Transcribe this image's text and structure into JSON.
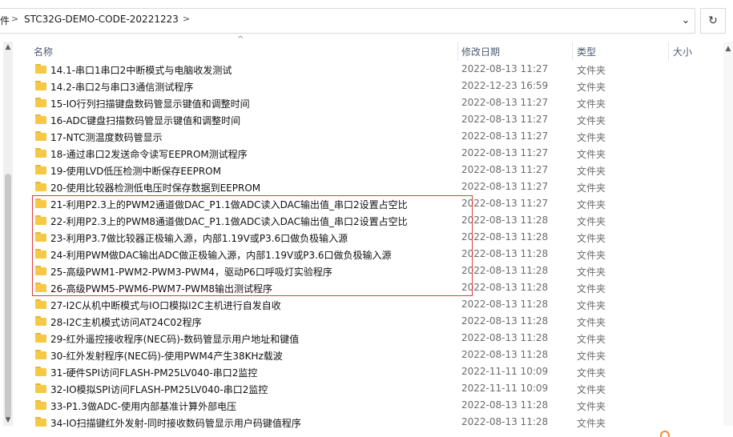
{
  "address": {
    "prev_crumb": "件",
    "separator": ">",
    "path": "STC32G-DEMO-CODE-20221223",
    "dropdown_glyph": "⌄",
    "refresh_glyph": "↻"
  },
  "columns": {
    "name": "名称",
    "date": "修改日期",
    "type": "类型",
    "size": "大小",
    "sort_glyph": "^"
  },
  "scroll": {
    "up": "▲",
    "down": "▼"
  },
  "rows": [
    {
      "name": "14.1-串口1串口2中断模式与电脑收发测试",
      "date": "2022-08-13 11:27",
      "type": "文件夹"
    },
    {
      "name": "14.2-串口2与串口3通信测试程序",
      "date": "2022-12-23 16:59",
      "type": "文件夹"
    },
    {
      "name": "15-IO行列扫描键盘数码管显示键值和调整时间",
      "date": "2022-08-13 11:27",
      "type": "文件夹"
    },
    {
      "name": "16-ADC键盘扫描数码管显示键值和调整时间",
      "date": "2022-08-13 11:27",
      "type": "文件夹"
    },
    {
      "name": "17-NTC测温度数码管显示",
      "date": "2022-08-13 11:27",
      "type": "文件夹"
    },
    {
      "name": "18-通过串口2发送命令读写EEPROM测试程序",
      "date": "2022-08-13 11:27",
      "type": "文件夹"
    },
    {
      "name": "19-使用LVD低压检测中断保存EEPROM",
      "date": "2022-08-13 11:27",
      "type": "文件夹"
    },
    {
      "name": "20-使用比较器检测低电压时保存数据到EEPROM",
      "date": "2022-08-13 11:27",
      "type": "文件夹"
    },
    {
      "name": "21-利用P2.3上的PWM2通道做DAC_P1.1做ADC读入DAC输出值_串口2设置占空比",
      "date": "2022-08-13 11:27",
      "type": "文件夹"
    },
    {
      "name": "22-利用P2.3上的PWM8通道做DAC_P1.1做ADC读入DAC输出值_串口2设置占空比",
      "date": "2022-08-13 11:28",
      "type": "文件夹"
    },
    {
      "name": "23-利用P3.7做比较器正极输入源，内部1.19V或P3.6口做负极输入源",
      "date": "2022-08-13 11:28",
      "type": "文件夹"
    },
    {
      "name": "24-利用PWM做DAC输出ADC做正极输入源，内部1.19V或P3.6口做负极输入源",
      "date": "2022-08-13 11:28",
      "type": "文件夹"
    },
    {
      "name": "25-高级PWM1-PWM2-PWM3-PWM4，驱动P6口呼吸灯实验程序",
      "date": "2022-08-13 11:28",
      "type": "文件夹"
    },
    {
      "name": "26-高级PWM5-PWM6-PWM7-PWM8输出测试程序",
      "date": "2022-08-13 11:28",
      "type": "文件夹"
    },
    {
      "name": "27-I2C从机中断模式与IO口模拟I2C主机进行自发自收",
      "date": "2022-08-13 11:28",
      "type": "文件夹"
    },
    {
      "name": "28-I2C主机模式访问AT24C02程序",
      "date": "2022-08-13 11:28",
      "type": "文件夹"
    },
    {
      "name": "29-红外遥控接收程序(NEC码)-数码管显示用户地址和键值",
      "date": "2022-08-13 11:28",
      "type": "文件夹"
    },
    {
      "name": "30-红外发射程序(NEC码)-使用PWM4产生38KHz载波",
      "date": "2022-08-13 11:28",
      "type": "文件夹"
    },
    {
      "name": "31-硬件SPI访问FLASH-PM25LV040-串口2监控",
      "date": "2022-11-11 10:09",
      "type": "文件夹"
    },
    {
      "name": "32-IO模拟SPI访问FLASH-PM25LV040-串口2监控",
      "date": "2022-11-11 10:09",
      "type": "文件夹"
    },
    {
      "name": "33-P1.3做ADC-使用内部基准计算外部电压",
      "date": "2022-08-13 11:28",
      "type": "文件夹"
    },
    {
      "name": "34-IO扫描键红外发射-同时接收数码管显示用户码键值程序",
      "date": "2022-08-13 11:28",
      "type": "文件夹"
    }
  ],
  "colors": {
    "highlight": "#e13b3b",
    "folder": "#f6c945"
  }
}
